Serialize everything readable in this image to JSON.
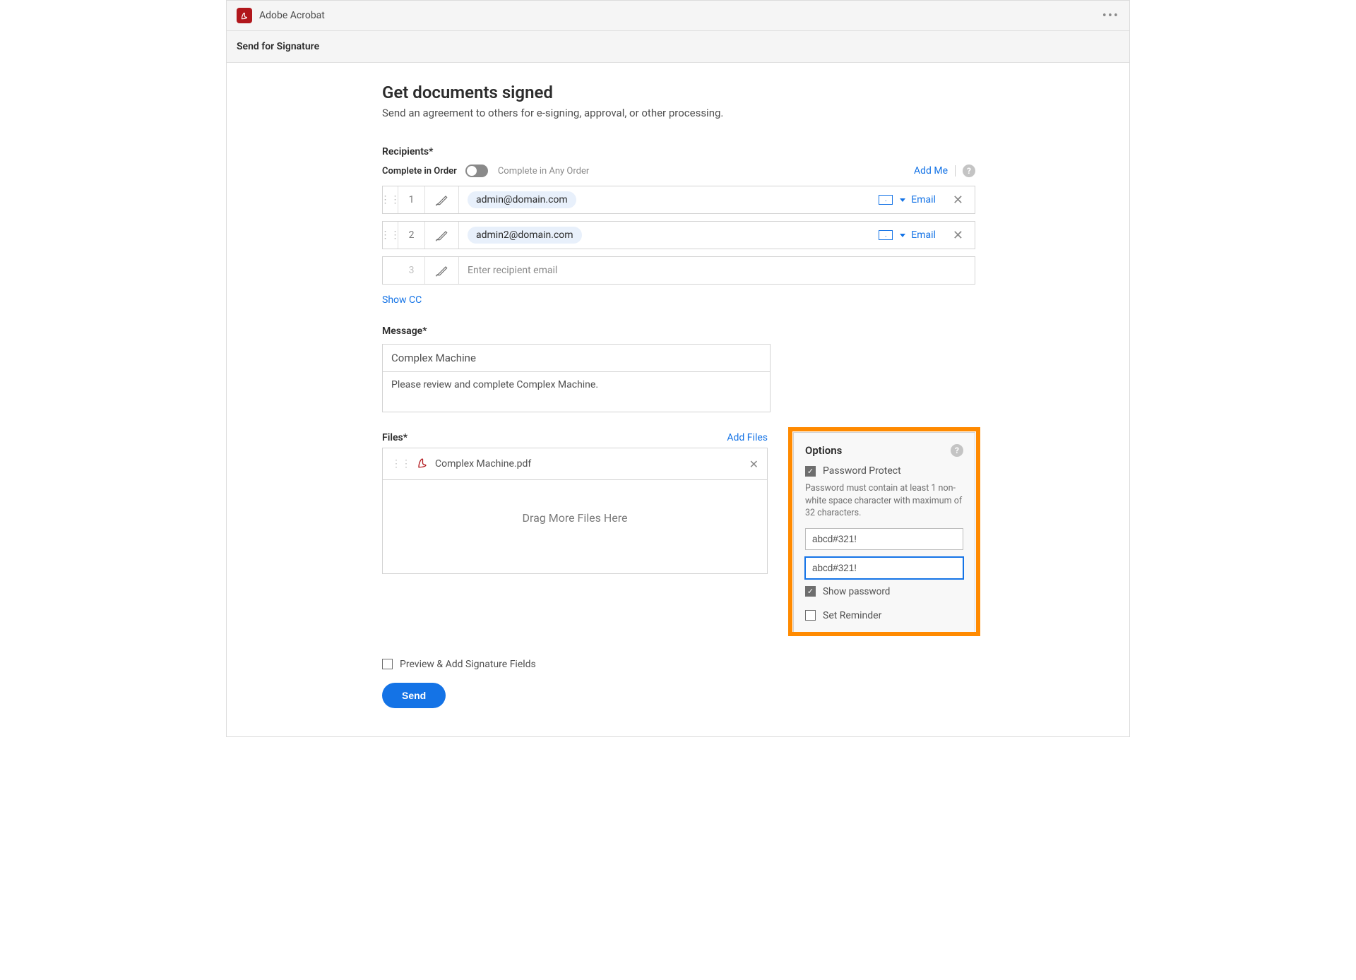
{
  "app": {
    "name": "Adobe Acrobat"
  },
  "subheader": "Send for Signature",
  "page": {
    "title": "Get documents signed",
    "subtitle": "Send an agreement to others for e-signing, approval, or other processing."
  },
  "recipients": {
    "label": "Recipients*",
    "complete_in_order": "Complete in Order",
    "complete_any_order": "Complete in Any Order",
    "add_me": "Add Me",
    "rows": [
      {
        "num": "1",
        "email": "admin@domain.com",
        "method": "Email"
      },
      {
        "num": "2",
        "email": "admin2@domain.com",
        "method": "Email"
      },
      {
        "num": "3",
        "placeholder": "Enter recipient email"
      }
    ],
    "show_cc": "Show CC"
  },
  "message": {
    "label": "Message*",
    "subject": "Complex Machine",
    "body": "Please review and complete Complex Machine."
  },
  "files": {
    "label": "Files*",
    "add_files": "Add Files",
    "items": [
      {
        "name": "Complex Machine.pdf"
      }
    ],
    "dropzone": "Drag More Files Here"
  },
  "options": {
    "title": "Options",
    "password_protect": "Password Protect",
    "pw_help": "Password must contain at least 1 non-white space character with maximum of 32 characters.",
    "pw1": "abcd#321!",
    "pw2": "abcd#321!",
    "show_password": "Show password",
    "set_reminder": "Set Reminder"
  },
  "preview_label": "Preview & Add Signature Fields",
  "send_label": "Send"
}
